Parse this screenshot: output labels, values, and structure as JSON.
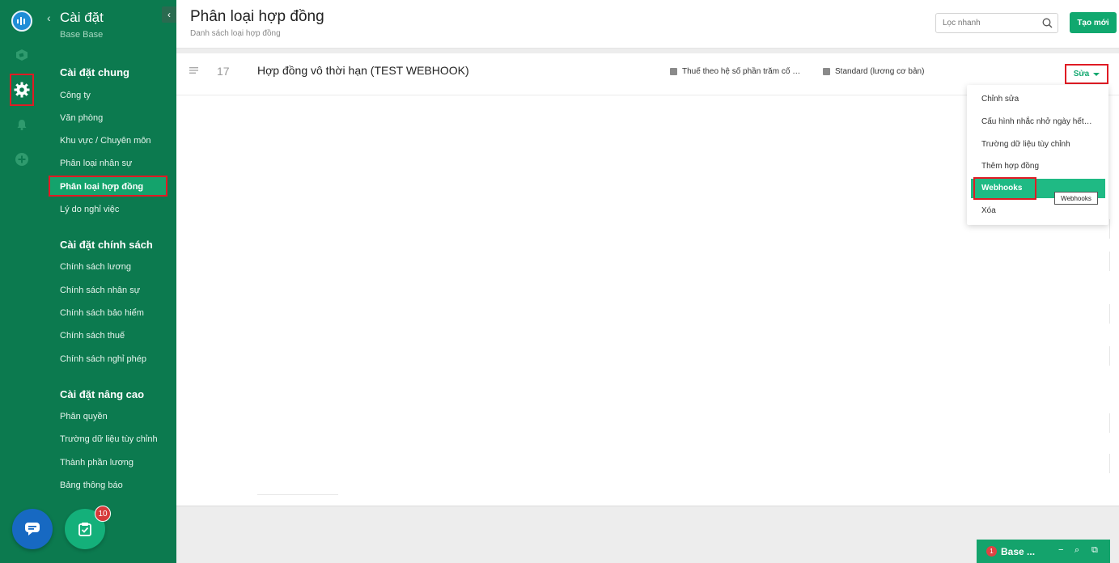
{
  "sidebar": {
    "back_icon": "‹",
    "title": "Cài đặt",
    "subtitle": "Base Base",
    "collapse_icon": "‹",
    "groups": [
      {
        "label": "Cài đặt chung"
      },
      {
        "label": "Cài đặt chính sách"
      },
      {
        "label": "Cài đặt nâng cao"
      }
    ],
    "items": [
      {
        "label": "Công ty"
      },
      {
        "label": "Văn phòng"
      },
      {
        "label": "Khu vực / Chuyên môn"
      },
      {
        "label": "Phân loại nhân sự"
      },
      {
        "label": "Phân loại hợp đồng"
      },
      {
        "label": "Lý do nghỉ việc"
      },
      {
        "label": "Chính sách lương"
      },
      {
        "label": "Chính sách nhân sự"
      },
      {
        "label": "Chính sách bảo hiểm"
      },
      {
        "label": "Chính sách thuế"
      },
      {
        "label": "Chính sách nghỉ phép"
      },
      {
        "label": "Phân quyền"
      },
      {
        "label": "Trường dữ liệu tùy chỉnh"
      },
      {
        "label": "Thành phần lương"
      },
      {
        "label": "Bảng thông báo"
      }
    ],
    "active_item": "Phân loại hợp đồng"
  },
  "rail": {
    "icons": [
      "logo-icon",
      "cube-icon",
      "gear-icon",
      "bell-icon",
      "plus-circle-icon"
    ],
    "active": "gear-icon"
  },
  "fab": {
    "task_badge": "10"
  },
  "header": {
    "title": "Phân loại hợp đồng",
    "subtitle": "Danh sách loại hợp đồng",
    "search_placeholder": "Lọc nhanh",
    "create_label": "Tạo mới"
  },
  "row": {
    "number": "17",
    "name": "Hợp đồng vô thời hạn (TEST WEBHOOK)",
    "tag1": "Thuế theo hệ số phần trăm cố …",
    "tag2": "Standard (lương cơ bản)",
    "edit_label": "Sửa"
  },
  "menu": {
    "items": [
      {
        "label": "Chỉnh sửa"
      },
      {
        "label": "Cấu hình nhắc nhở ngày hết…"
      },
      {
        "label": "Trường dữ liệu tùy chỉnh"
      },
      {
        "label": "Thêm hợp đồng"
      },
      {
        "label": "Webhooks"
      },
      {
        "label": "Xóa"
      }
    ],
    "highlighted": "Webhooks",
    "tooltip": "Webhooks"
  },
  "chat": {
    "badge": "1",
    "title": "Base ...",
    "minimize_icon": "−",
    "search_icon": "⌕",
    "popout_icon": "⧉"
  },
  "colors": {
    "sidebar_bg": "#0c7a4f",
    "accent": "#11a86f",
    "highlight_box": "#e01b24"
  }
}
